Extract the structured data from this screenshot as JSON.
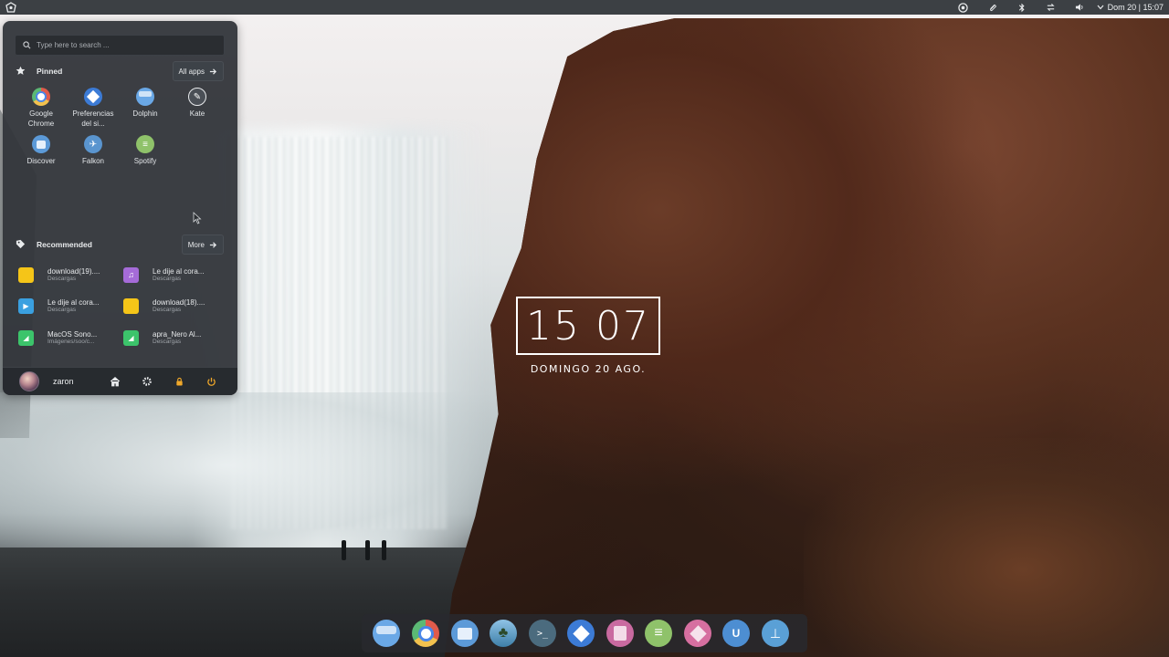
{
  "top_panel": {
    "launcher_icon": "app-launcher-icon",
    "tray_icons": [
      "system-settings-icon",
      "attachment-icon",
      "bluetooth-icon",
      "network-icon",
      "volume-icon",
      "chevron-down-icon"
    ],
    "clock_text": "Dom 20 | 15:07"
  },
  "menu": {
    "search": {
      "placeholder": "Type here to search ..."
    },
    "pinned": {
      "title": "Pinned",
      "button_label": "All apps",
      "apps": [
        {
          "label": "Google Chrome",
          "icon": "chrome-icon",
          "color": "#e05b4b"
        },
        {
          "label": "Preferencias del si...",
          "icon": "preferences-icon",
          "color": "#3c7bd6"
        },
        {
          "label": "Dolphin",
          "icon": "folder-icon",
          "color": "#6aa8e6"
        },
        {
          "label": "Kate",
          "icon": "kate-icon",
          "color": "#4a4f56"
        },
        {
          "label": "Discover",
          "icon": "discover-icon",
          "color": "#5c9ad8"
        },
        {
          "label": "Falkon",
          "icon": "falkon-icon",
          "color": "#5a95cf"
        },
        {
          "label": "Spotify",
          "icon": "spotify-icon",
          "color": "#8fc26a"
        }
      ]
    },
    "recommended": {
      "title": "Recommended",
      "button_label": "More",
      "items": [
        {
          "name": "download(19)....",
          "location": "Descargas",
          "icon": "image-file-icon",
          "color": "#f5c518"
        },
        {
          "name": "Le dije al cora...",
          "location": "Descargas",
          "icon": "audio-file-icon",
          "color": "#a56bd8"
        },
        {
          "name": "Le dije al cora...",
          "location": "Descargas",
          "icon": "video-file-icon",
          "color": "#3aa0e0"
        },
        {
          "name": "download(18)....",
          "location": "Descargas",
          "icon": "image-file-icon",
          "color": "#f5c518"
        },
        {
          "name": "MacOS Sono...",
          "location": "Imágenes/soo/c...",
          "icon": "picture-file-icon",
          "color": "#3cc46b"
        },
        {
          "name": "apra_Nero Al...",
          "location": "Descargas",
          "icon": "picture-file-icon",
          "color": "#3cc46b"
        }
      ]
    },
    "user": {
      "name": "zaron"
    },
    "footer_icons": [
      "home-icon",
      "settings-icon",
      "lock-icon",
      "power-icon"
    ]
  },
  "clock_widget": {
    "time": "15 07",
    "date": "DOMINGO  20 AGO."
  },
  "dock": {
    "icons": [
      {
        "name": "dolphin-icon",
        "color": "#6aa8e6"
      },
      {
        "name": "chrome-icon",
        "color": "#e05b4b"
      },
      {
        "name": "discover-icon",
        "color": "#5c9ad8"
      },
      {
        "name": "wallpaper-icon",
        "color": "#5fa0c8"
      },
      {
        "name": "terminal-icon",
        "color": "#4b6b7e"
      },
      {
        "name": "preferences-icon",
        "color": "#3c7bd6"
      },
      {
        "name": "kamoso-icon",
        "color": "#c96aa0"
      },
      {
        "name": "spotify-icon",
        "color": "#8fc26a"
      },
      {
        "name": "krita-icon",
        "color": "#d66fa0"
      },
      {
        "name": "ark-icon",
        "color": "#4d8ed2"
      },
      {
        "name": "kdenlive-icon",
        "color": "#5aa0d6"
      }
    ]
  }
}
